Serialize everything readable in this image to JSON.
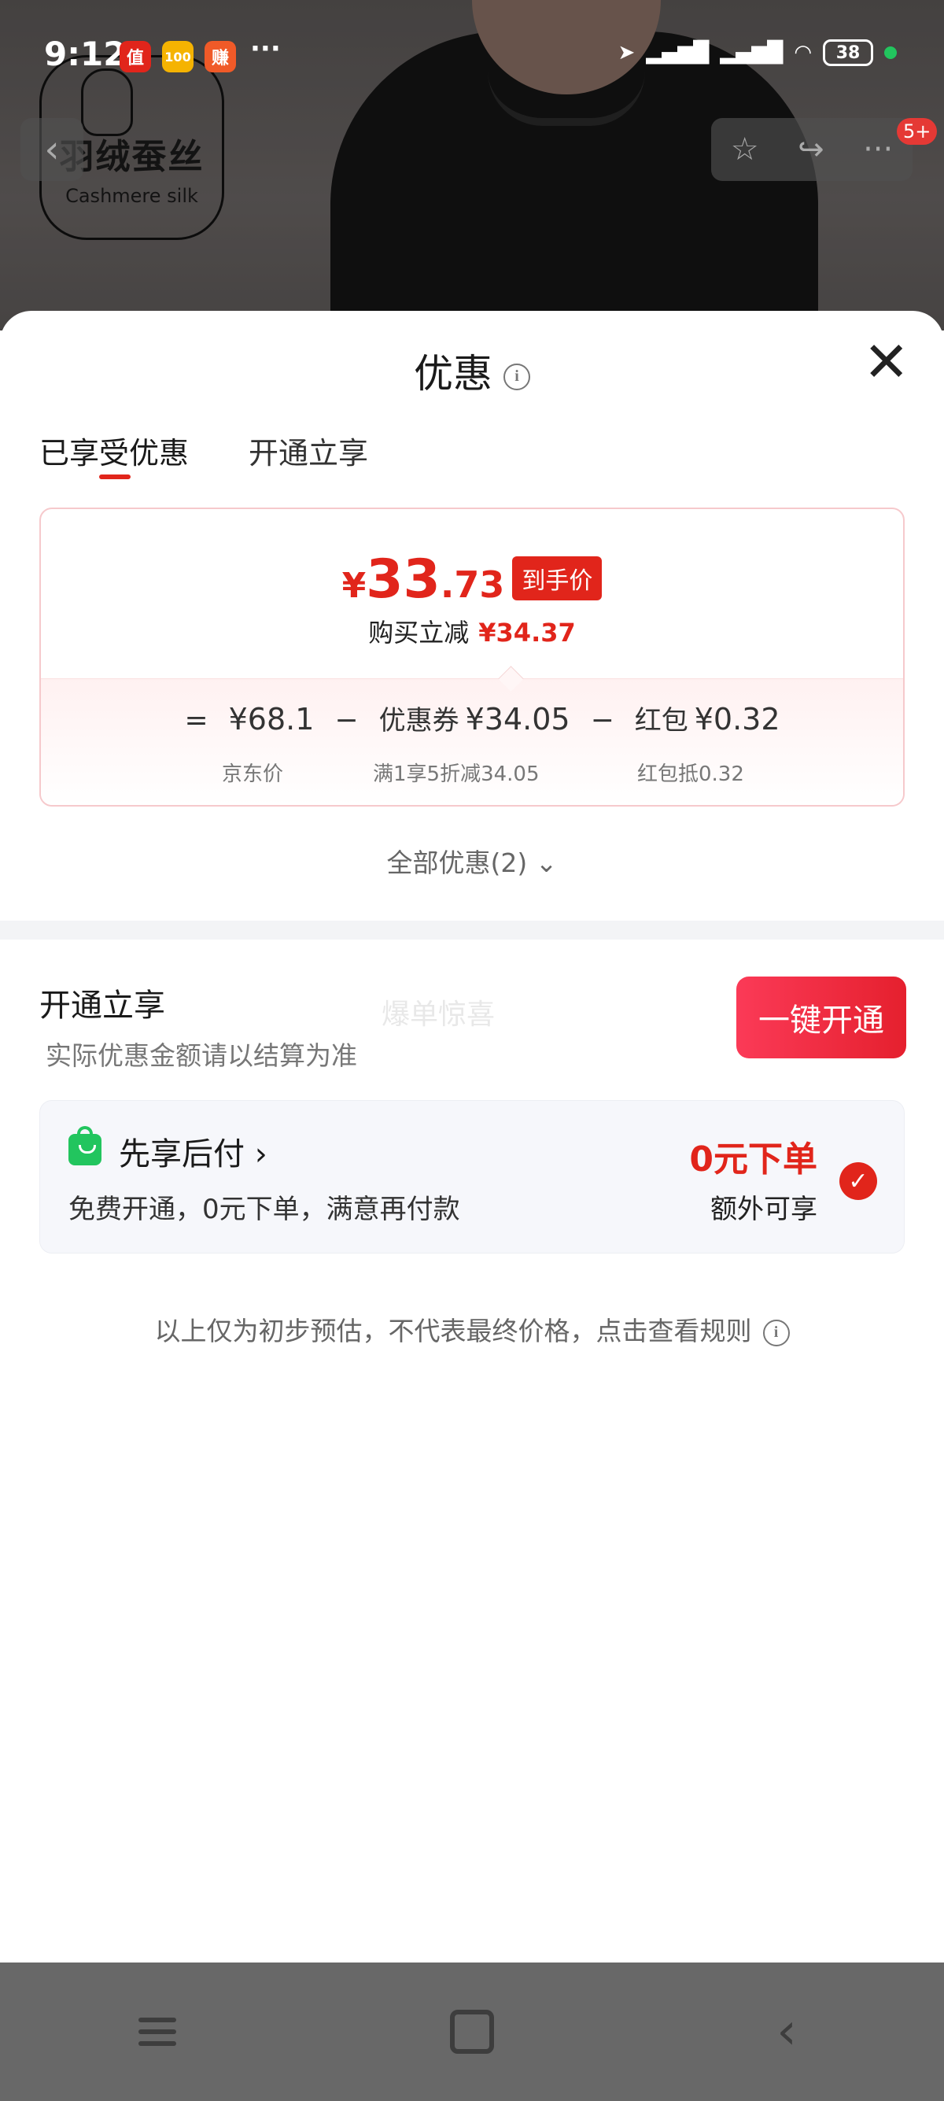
{
  "status_bar": {
    "time": "9:12",
    "app_icons": [
      "值",
      "100",
      "赚"
    ],
    "more": "···",
    "battery": "38"
  },
  "product_bg": {
    "brand_cn": "羽绒蚕丝",
    "brand_en": "Cashmere silk",
    "cart_badge": "5+"
  },
  "sheet": {
    "title": "优惠",
    "tabs": [
      {
        "label": "已享受优惠",
        "active": true
      },
      {
        "label": "开通立享",
        "active": false
      }
    ],
    "price": {
      "currency": "¥",
      "integer": "33",
      "decimal": ".73",
      "tag": "到手价",
      "reduce_label": "购买立减",
      "reduce_amount": "¥34.37"
    },
    "formula": {
      "equals": "=",
      "minus": "−",
      "items": [
        {
          "label": "",
          "value": "¥68.1",
          "sub": "京东价"
        },
        {
          "label": "优惠券",
          "value": "¥34.05",
          "sub": "满1享5折减34.05"
        },
        {
          "label": "红包",
          "value": "¥0.32",
          "sub": "红包抵0.32"
        }
      ]
    },
    "all_discounts": "全部优惠(2)",
    "open_section": {
      "title": "开通立享",
      "subtitle": "实际优惠金额请以结算为准",
      "faint_text": "爆单惊喜",
      "button": "一键开通"
    },
    "pay_later": {
      "title": "先享后付",
      "desc": "免费开通，0元下单，满意再付款",
      "highlight": "0元下单",
      "extra": "额外可享",
      "checked": true
    },
    "disclaimer": "以上仅为初步预估，不代表最终价格，点击查看规则"
  },
  "colors": {
    "accent_red": "#e1251b",
    "button_red": "#f0263a",
    "green": "#22c55e"
  }
}
